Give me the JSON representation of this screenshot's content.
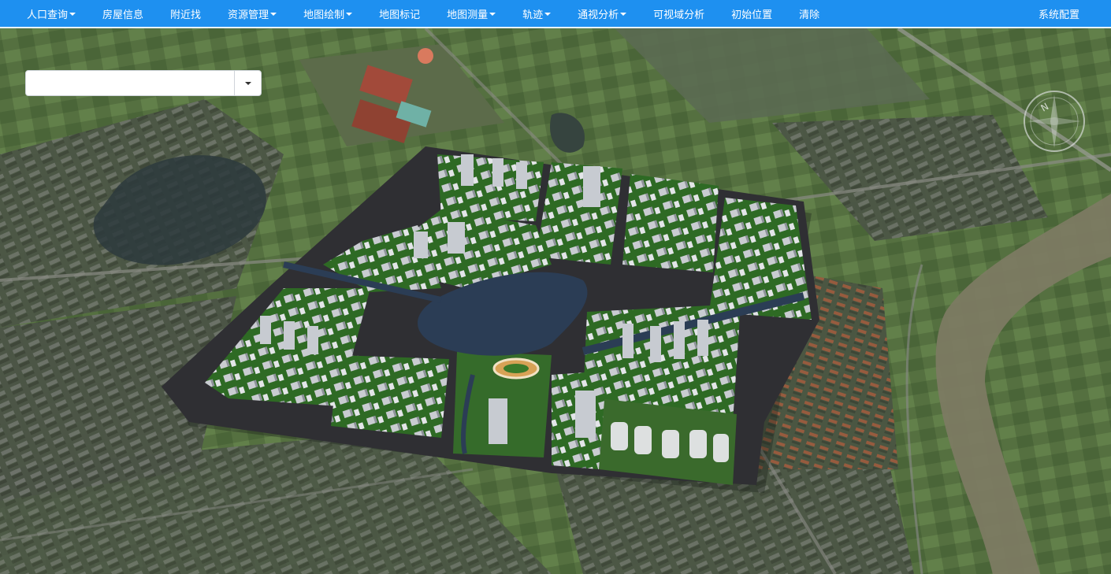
{
  "navbar": {
    "items": [
      {
        "label": "人口查询",
        "dropdown": true
      },
      {
        "label": "房屋信息",
        "dropdown": false
      },
      {
        "label": "附近找",
        "dropdown": false
      },
      {
        "label": "资源管理",
        "dropdown": true
      },
      {
        "label": "地图绘制",
        "dropdown": true
      },
      {
        "label": "地图标记",
        "dropdown": false
      },
      {
        "label": "地图测量",
        "dropdown": true
      },
      {
        "label": "轨迹",
        "dropdown": true
      },
      {
        "label": "通视分析",
        "dropdown": true
      },
      {
        "label": "可视域分析",
        "dropdown": false
      },
      {
        "label": "初始位置",
        "dropdown": false
      },
      {
        "label": "清除",
        "dropdown": false
      }
    ],
    "right_label": "系统配置"
  },
  "search": {
    "value": "",
    "placeholder": ""
  },
  "compass": {
    "letter": "N"
  },
  "colors": {
    "navbar": "#1e90f0",
    "road": "#2f2f33",
    "lake": "#2b3d55",
    "river": "#7c7a62",
    "greenery": "#3d6b2a"
  }
}
